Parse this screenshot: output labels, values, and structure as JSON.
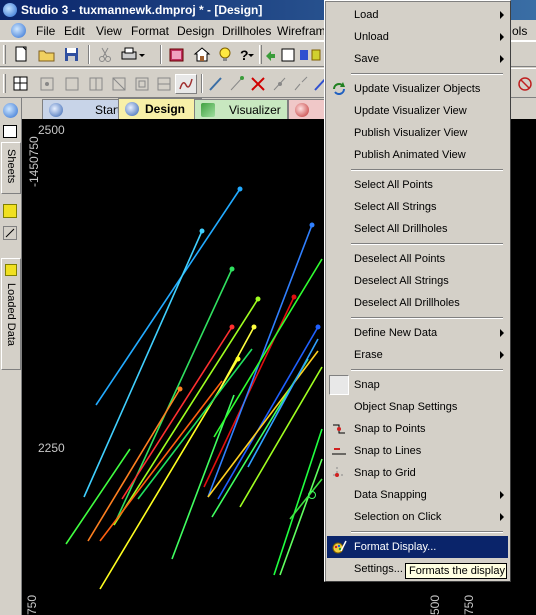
{
  "window": {
    "title": "Studio 3 - tuxmannewk.dmproj * - [Design]"
  },
  "menubar": {
    "items": [
      {
        "label": "File",
        "ul": "F"
      },
      {
        "label": "Edit",
        "ul": "E"
      },
      {
        "label": "View",
        "ul": "V"
      },
      {
        "label": "Format",
        "ul": "o"
      },
      {
        "label": "Design",
        "ul": "D"
      },
      {
        "label": "Drillholes",
        "ul": "D"
      },
      {
        "label": "Wirefram",
        "ul": "W"
      },
      {
        "label": "ols",
        "ul": ""
      }
    ]
  },
  "sidebar": {
    "sheets_label": "Sheets",
    "loaded_data_label": "Loaded Data"
  },
  "tabs": [
    {
      "label": "Start"
    },
    {
      "label": "Design"
    },
    {
      "label": "Visualizer"
    }
  ],
  "viewport": {
    "background": "#000000",
    "y_labels": [
      "2500",
      "2250"
    ],
    "y_vertical_labels": [
      "-1450750",
      "750"
    ],
    "x_labels": [
      "500",
      "750"
    ]
  },
  "context_menu": {
    "items": [
      {
        "label": "Load",
        "submenu": true
      },
      {
        "label": "Unload",
        "submenu": true
      },
      {
        "label": "Save",
        "submenu": true
      },
      {
        "sep": true
      },
      {
        "label": "Update Visualizer Objects",
        "icon": "update-visualizer-objects-icon"
      },
      {
        "label": "Update Visualizer View"
      },
      {
        "label": "Publish Visualizer View"
      },
      {
        "label": "Publish Animated View"
      },
      {
        "sep": true
      },
      {
        "label": "Select All Points"
      },
      {
        "label": "Select All Strings"
      },
      {
        "label": "Select All Drillholes"
      },
      {
        "sep": true
      },
      {
        "label": "Deselect All Points"
      },
      {
        "label": "Deselect All Strings"
      },
      {
        "label": "Deselect All Drillholes"
      },
      {
        "sep": true
      },
      {
        "label": "Define New Data",
        "submenu": true
      },
      {
        "label": "Erase",
        "submenu": true
      },
      {
        "sep": true
      },
      {
        "label": "Snap",
        "icon": "snap-checkbox-icon"
      },
      {
        "label": "Object Snap Settings"
      },
      {
        "label": "Snap to Points",
        "icon": "snap-to-points-icon"
      },
      {
        "label": "Snap to Lines",
        "icon": "snap-to-lines-icon"
      },
      {
        "label": "Snap to Grid",
        "icon": "snap-to-grid-icon"
      },
      {
        "label": "Data Snapping",
        "submenu": true
      },
      {
        "label": "Selection on Click",
        "submenu": true
      },
      {
        "sep": true
      },
      {
        "label": "Format Display...",
        "icon": "format-display-icon",
        "highlighted": true
      },
      {
        "label": "Settings..."
      }
    ]
  },
  "tooltip": {
    "text": "Formats the display"
  },
  "colors": {
    "highlight": "#0a246a",
    "menu_bg": "#d4d0c8",
    "tooltip_bg": "#ffffe1"
  }
}
